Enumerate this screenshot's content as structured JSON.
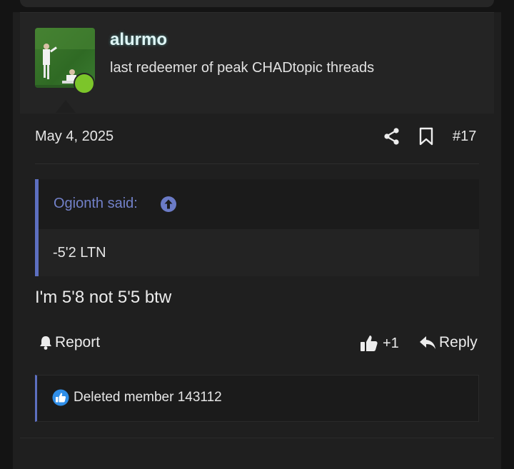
{
  "user": {
    "name": "alurmo",
    "title": "last redeemer of peak CHADtopic threads",
    "online_color": "#7cc52a"
  },
  "post": {
    "date": "May 4, 2025",
    "number": "#17",
    "share_icon": "share-icon",
    "bookmark_icon": "bookmark-icon"
  },
  "quote": {
    "author_label": "Ogionth said:",
    "text": "-5'2 LTN",
    "accent": "#5d6fc0"
  },
  "message": "I'm 5'8 not 5'5 btw",
  "actions": {
    "report": "Report",
    "like_count": "+1",
    "reply": "Reply"
  },
  "reactions": {
    "text": "Deleted member 143112",
    "icon": "like-icon",
    "icon_color": "#2f8ee8"
  }
}
